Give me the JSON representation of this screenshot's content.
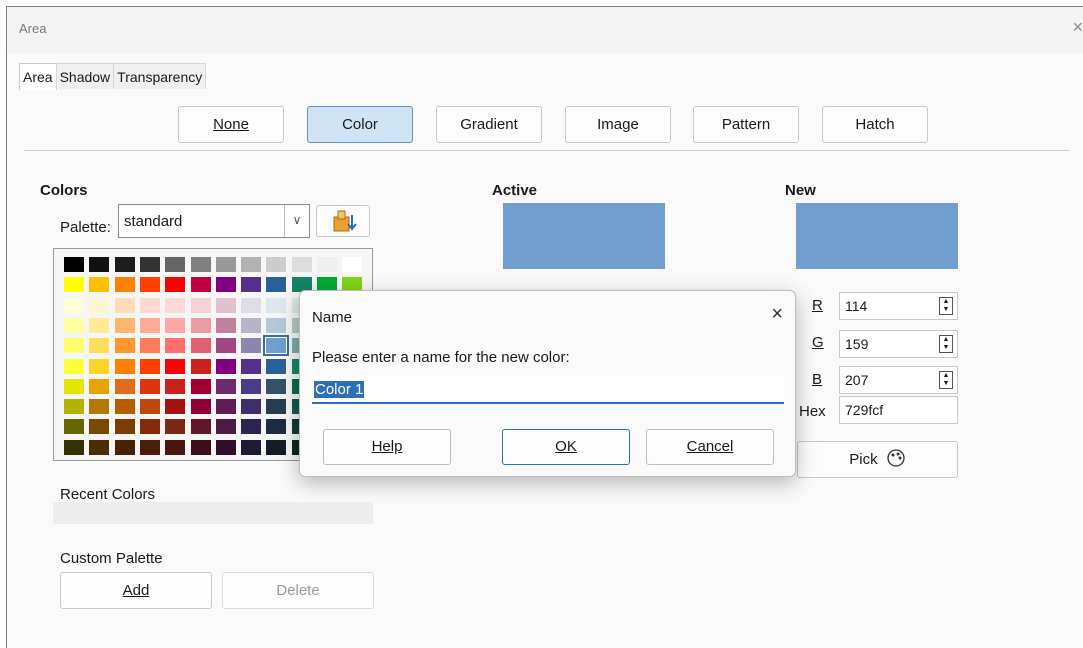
{
  "window": {
    "title": "Area",
    "close": "×"
  },
  "tabs": [
    "Area",
    "Shadow",
    "Transparency"
  ],
  "fill_buttons": {
    "none": "None",
    "color": "Color",
    "gradient": "Gradient",
    "image": "Image",
    "pattern": "Pattern",
    "hatch": "Hatch",
    "selected": "Color"
  },
  "colors": {
    "heading": "Colors",
    "palette_label": "Palette:",
    "palette_value": "standard",
    "recent_label": "Recent Colors",
    "custom_label": "Custom Palette",
    "add": "Add",
    "delete": "Delete"
  },
  "active": {
    "heading": "Active",
    "color": "#729fcf"
  },
  "new": {
    "heading": "New",
    "color": "#729fcf",
    "r_label": "R",
    "g_label": "G",
    "b_label": "B",
    "hex_label": "Hex",
    "r": "114",
    "g": "159",
    "b": "207",
    "hex": "729fcf",
    "pick": "Pick"
  },
  "palette_colors": [
    [
      "#000000",
      "#111111",
      "#1c1c1c",
      "#333333",
      "#666666",
      "#808080",
      "#999999",
      "#b2b2b2",
      "#cccccc",
      "#dddddd",
      "#eeeeee",
      "#ffffff"
    ],
    [
      "#ffff00",
      "#ffbf00",
      "#ff8000",
      "#ff4000",
      "#ff0000",
      "#bf0041",
      "#800080",
      "#55308d",
      "#2a6099",
      "#158466",
      "#00a933",
      "#81d41a"
    ],
    [
      "#ffffd7",
      "#fff5ce",
      "#ffdbb6",
      "#ffd8ce",
      "#ffd7d7",
      "#f7d1d5",
      "#e0c2cd",
      "#dedce6",
      "#dee6ef",
      "#dee7e5",
      "#dde8cb",
      "#f6f9d4"
    ],
    [
      "#ffffa6",
      "#ffe994",
      "#ffb66c",
      "#ffaa95",
      "#ffa6a6",
      "#ec9ba4",
      "#bf819e",
      "#b7b3ca",
      "#b4c7dc",
      "#b3cac7",
      "#afd095",
      "#e8f2a1"
    ],
    [
      "#ffff6d",
      "#ffde59",
      "#ff972f",
      "#ff7b59",
      "#ff6d6d",
      "#e16173",
      "#a1467e",
      "#8e86ae",
      "#729fcf",
      "#81aca6",
      "#77bc65",
      "#d4ea6b"
    ],
    [
      "#ffff38",
      "#ffd428",
      "#ff8000",
      "#ff4000",
      "#ff0000",
      "#c9211e",
      "#800080",
      "#55308d",
      "#2a6099",
      "#158466",
      "#00a933",
      "#81d41a"
    ],
    [
      "#e6e600",
      "#e8a202",
      "#e16b1a",
      "#e0330e",
      "#c9211e",
      "#a0002d",
      "#6d2c6b",
      "#483d8b",
      "#355269",
      "#0d6a4d",
      "#127622",
      "#5eb91e"
    ],
    [
      "#b2b200",
      "#b47804",
      "#b85c00",
      "#be480a",
      "#a2110e",
      "#8d0034",
      "#5e1d52",
      "#3e2e6b",
      "#283c50",
      "#17554b",
      "#1e6a39",
      "#468a1a"
    ],
    [
      "#666600",
      "#7a4a00",
      "#7b3d00",
      "#822b0d",
      "#7b2817",
      "#611729",
      "#4b1d45",
      "#2d2451",
      "#1e2c3f",
      "#113b33",
      "#1d4c2f",
      "#355f1b"
    ],
    [
      "#333300",
      "#4a2e00",
      "#492300",
      "#4b1f0b",
      "#4a1712",
      "#3b0e1a",
      "#300d2a",
      "#1d1a35",
      "#141c27",
      "#0c2520",
      "#102b1b",
      "#1f3510"
    ]
  ],
  "name_dialog": {
    "title": "Name",
    "close": "×",
    "prompt": "Please enter a name for the new color:",
    "value": "Color 1",
    "help": "Help",
    "ok": "OK",
    "cancel": "Cancel"
  }
}
